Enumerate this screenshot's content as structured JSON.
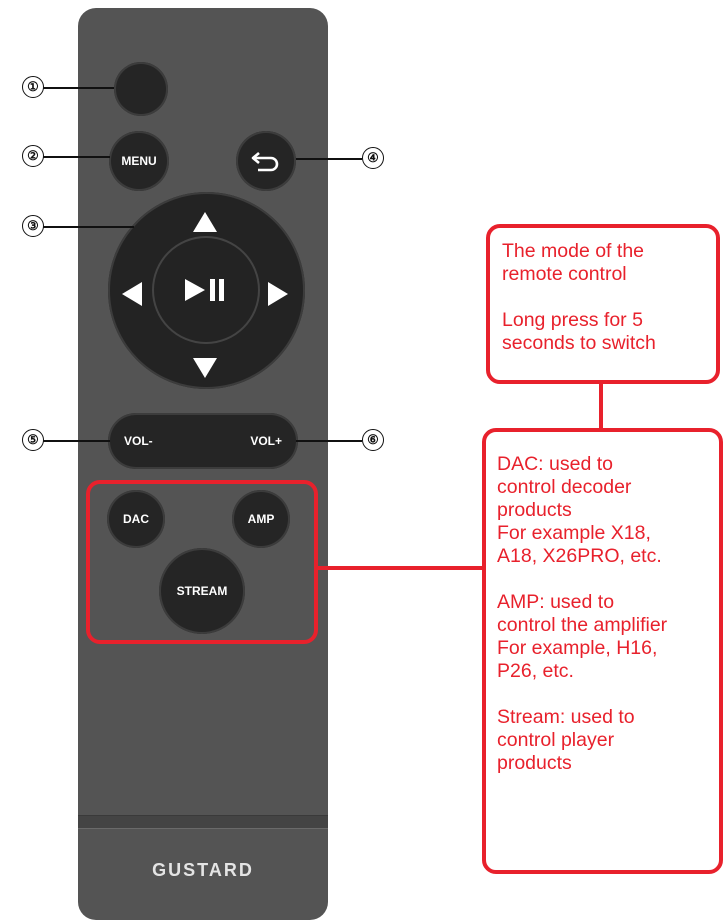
{
  "remote": {
    "buttons": {
      "menu": "MENU",
      "vol_minus": "VOL-",
      "vol_plus": "VOL+",
      "dac": "DAC",
      "amp": "AMP",
      "stream": "STREAM"
    },
    "brand": "GUSTARD",
    "icons": [
      "back-arrow-icon",
      "up-arrow-icon",
      "down-arrow-icon",
      "left-arrow-icon",
      "right-arrow-icon",
      "play-pause-icon"
    ]
  },
  "callouts": [
    "①",
    "②",
    "③",
    "④",
    "⑤",
    "⑥"
  ],
  "notes": {
    "mode": {
      "line1": "The mode of the",
      "line2": "remote control",
      "line3": "Long press for 5",
      "line4": "seconds to switch"
    },
    "details": {
      "l1": "DAC: used to",
      "l2": "control decoder",
      "l3": "products",
      "l4": "For example X18,",
      "l5": "A18, X26PRO, etc.",
      "l6": "AMP: used to",
      "l7": "control the amplifier",
      "l8": "For example, H16,",
      "l9": "P26, etc.",
      "l10": "Stream: used to",
      "l11": "control player",
      "l12": "products"
    }
  },
  "colors": {
    "remote_body": "#545454",
    "button": "#252525",
    "annotation_red": "#e8212c"
  }
}
